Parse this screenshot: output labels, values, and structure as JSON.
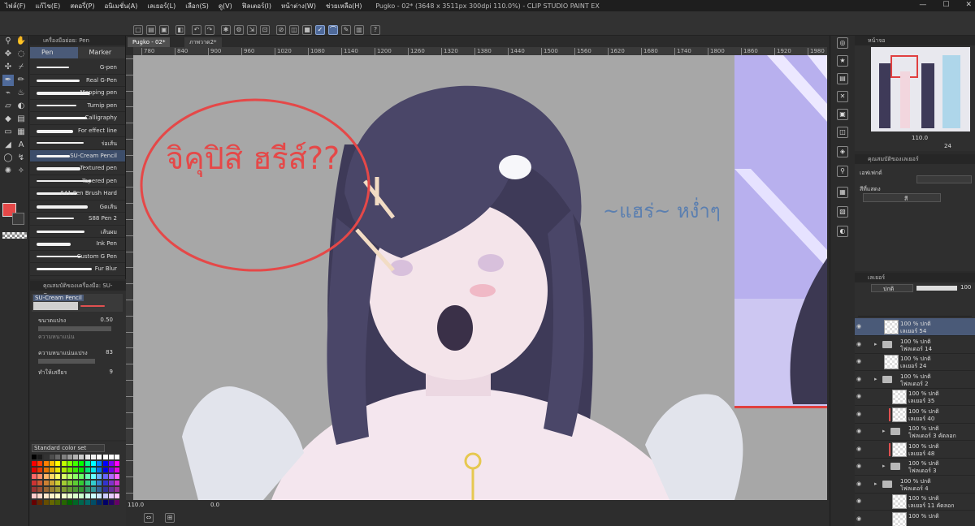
{
  "app": {
    "title": "Pugko - 02* (3648 x 3511px 300dpi 110.0%)  - CLIP STUDIO PAINT EX",
    "menu": [
      "ไฟล์(F)",
      "แก้ไข(E)",
      "สตอรี่(P)",
      "อนิเมชั่น(A)",
      "เลเยอร์(L)",
      "เลือก(S)",
      "ดู(V)",
      "ฟิลเตอร์(I)",
      "หน้าต่าง(W)",
      "ช่วยเหลือ(H)"
    ],
    "window_controls": [
      "—",
      "☐",
      "✕"
    ]
  },
  "doc_tabs": [
    {
      "label": "Pugko - 02*",
      "active": true
    },
    {
      "label": "ภาพวาด2*",
      "active": false
    }
  ],
  "ruler": {
    "h_ticks": [
      "780",
      "840",
      "900",
      "960",
      "1020",
      "1080",
      "1140",
      "1200",
      "1260",
      "1320",
      "1380",
      "1440",
      "1500",
      "1560",
      "1620",
      "1680",
      "1740",
      "1800",
      "1860",
      "1920",
      "1980"
    ],
    "v_ticks": [
      "1000",
      "1020",
      "1040",
      "1060",
      "1080",
      "1100",
      "1120",
      "1140",
      "1160",
      "1180",
      "1200",
      "1220",
      "1240",
      "1260",
      "1280",
      "1300",
      "1320",
      "1340",
      "1360",
      "1380",
      "1400",
      "1420",
      "1440",
      "1460",
      "1480",
      "1500",
      "1520",
      "1540"
    ]
  },
  "subtool": {
    "header": "เครื่องมือย่อย: Pen",
    "tabs": [
      {
        "label": "Pen",
        "active": true
      },
      {
        "label": "Marker",
        "active": false
      }
    ],
    "brushes": [
      {
        "label": "G-pen",
        "active": false
      },
      {
        "label": "Real G-Pen",
        "active": false
      },
      {
        "label": "Mapping pen",
        "active": false
      },
      {
        "label": "Turnip pen",
        "active": false
      },
      {
        "label": "Calligraphy",
        "active": false
      },
      {
        "label": "For effect line",
        "active": false
      },
      {
        "label": "ร่อเส้น",
        "active": false
      },
      {
        "label": "SU-Cream Pencil",
        "active": true
      },
      {
        "label": "Textured pen",
        "active": false
      },
      {
        "label": "Tapered pen",
        "active": false
      },
      {
        "label": "641 Pen Brush Hard",
        "active": false
      },
      {
        "label": "Gตเส้น",
        "active": false
      },
      {
        "label": "S88 Pen 2",
        "active": false
      },
      {
        "label": "เส้นผม",
        "active": false
      },
      {
        "label": "Ink Pen",
        "active": false
      },
      {
        "label": "Custom G Pen",
        "active": false
      },
      {
        "label": "Fur Blur",
        "active": false
      }
    ]
  },
  "tool_property": {
    "header": "คุณสมบัติของเครื่องมือ: SU-Cream",
    "brush_name": "SU-Cream Pencil",
    "props": [
      {
        "label": "ขนาดแปรง",
        "value": "0.50"
      },
      {
        "label": "ความหนาแน่น",
        "value": ""
      },
      {
        "label": "ความหนาแน่นแปรง",
        "value": "83"
      },
      {
        "label": "ทำให้เสถียร",
        "value": "9"
      }
    ]
  },
  "colorset": {
    "selector": "Standard color set",
    "colors": [
      "#000000",
      "#1a1a1a",
      "#333333",
      "#4d4d4d",
      "#666666",
      "#808080",
      "#999999",
      "#b3b3b3",
      "#cccccc",
      "#e6e6e6",
      "#f2f2f2",
      "#ffffff",
      "#ffffff",
      "#ffffff",
      "#ffffff",
      "#ff0000",
      "#ff4000",
      "#ff8000",
      "#ffbf00",
      "#ffff00",
      "#bfff00",
      "#80ff00",
      "#40ff00",
      "#00ff00",
      "#00ff80",
      "#00ffff",
      "#0080ff",
      "#0000ff",
      "#8000ff",
      "#ff00ff",
      "#e60000",
      "#e63900",
      "#e67300",
      "#e6ac00",
      "#e6e600",
      "#ace600",
      "#73e600",
      "#39e600",
      "#00e600",
      "#00e673",
      "#00e6e6",
      "#0073e6",
      "#0000e6",
      "#7300e6",
      "#e600e6",
      "#ff6666",
      "#ff8c66",
      "#ffb366",
      "#ffd966",
      "#ffff66",
      "#d9ff66",
      "#b3ff66",
      "#8cff66",
      "#66ff66",
      "#66ffb3",
      "#66ffff",
      "#66b3ff",
      "#6666ff",
      "#b366ff",
      "#ff66ff",
      "#cc3333",
      "#cc5c33",
      "#cc8033",
      "#cca333",
      "#cccc33",
      "#a3cc33",
      "#80cc33",
      "#5ccc33",
      "#33cc33",
      "#33cc80",
      "#33cccc",
      "#3380cc",
      "#3333cc",
      "#8033cc",
      "#cc33cc",
      "#993333",
      "#994d33",
      "#996633",
      "#998033",
      "#999933",
      "#809933",
      "#669933",
      "#4d9933",
      "#339933",
      "#339966",
      "#339999",
      "#336699",
      "#333399",
      "#663399",
      "#993399",
      "#ffcccc",
      "#ffd9cc",
      "#ffe6cc",
      "#fff2cc",
      "#ffffcc",
      "#f2ffcc",
      "#e6ffcc",
      "#d9ffcc",
      "#ccffcc",
      "#ccffe6",
      "#ccffff",
      "#cce6ff",
      "#ccccff",
      "#e6ccff",
      "#ffccff",
      "#660000",
      "#662600",
      "#664d00",
      "#666600",
      "#4d6600",
      "#266600",
      "#006600",
      "#006626",
      "#00664d",
      "#006666",
      "#004d66",
      "#002666",
      "#000066",
      "#260066",
      "#660066"
    ]
  },
  "current_color": "#e54848",
  "canvas": {
    "annotation_thai": "จิคุปิสิ ฮรีส์??",
    "annotation_blue": "~แฮร่~ หง่ำๆ",
    "annotation_color": "#e54848",
    "blue_ink": "#5b7fb0"
  },
  "status": {
    "zoom": "110.0",
    "angle": "0.0"
  },
  "navigator": {
    "header": "หน้าจอ",
    "zoom": "110.0",
    "angle": "24"
  },
  "color_panel": {
    "header": "คุณสมบัติของเลเยอร์",
    "effect_label": "เอฟเฟกต์",
    "color_label": "สีที่แสดง",
    "color_value": "สี"
  },
  "layers": {
    "header": "เลเยอร์",
    "blend_mode": "ปกติ",
    "opacity": "100",
    "rows": [
      {
        "line1": "100 % ปกติ",
        "line2": "เลเยอร์ 54",
        "kind": "layer",
        "selected": true,
        "indent": 0,
        "red": false
      },
      {
        "line1": "100 % ปกติ",
        "line2": "โฟลเดอร์ 14",
        "kind": "folder",
        "selected": false,
        "indent": 0,
        "red": false
      },
      {
        "line1": "100 % ปกติ",
        "line2": "เลเยอร์ 24",
        "kind": "layer",
        "selected": false,
        "indent": 0,
        "red": false
      },
      {
        "line1": "100 % ปกติ",
        "line2": "โฟลเดอร์ 2",
        "kind": "folder",
        "selected": false,
        "indent": 0,
        "red": false
      },
      {
        "line1": "100 % ปกติ",
        "line2": "เลเยอร์ 35",
        "kind": "layer",
        "selected": false,
        "indent": 1,
        "red": false
      },
      {
        "line1": "100 % ปกติ",
        "line2": "เลเยอร์ 40",
        "kind": "layer",
        "selected": false,
        "indent": 1,
        "red": true
      },
      {
        "line1": "100 % ปกติ",
        "line2": "โฟลเดอร์ 3 คัดลอก",
        "kind": "folder",
        "selected": false,
        "indent": 1,
        "red": false
      },
      {
        "line1": "100 % ปกติ",
        "line2": "เลเยอร์ 48",
        "kind": "layer",
        "selected": false,
        "indent": 1,
        "red": true
      },
      {
        "line1": "100 % ปกติ",
        "line2": "โฟลเดอร์ 3",
        "kind": "folder",
        "selected": false,
        "indent": 1,
        "red": false
      },
      {
        "line1": "100 % ปกติ",
        "line2": "โฟลเดอร์ 4",
        "kind": "folder",
        "selected": false,
        "indent": 0,
        "red": false
      },
      {
        "line1": "100 % ปกติ",
        "line2": "เลเยอร์ 11 คัดลอก",
        "kind": "layer",
        "selected": false,
        "indent": 1,
        "red": false
      },
      {
        "line1": "100 % ปกติ",
        "line2": "",
        "kind": "layer",
        "selected": false,
        "indent": 1,
        "red": false
      }
    ]
  }
}
